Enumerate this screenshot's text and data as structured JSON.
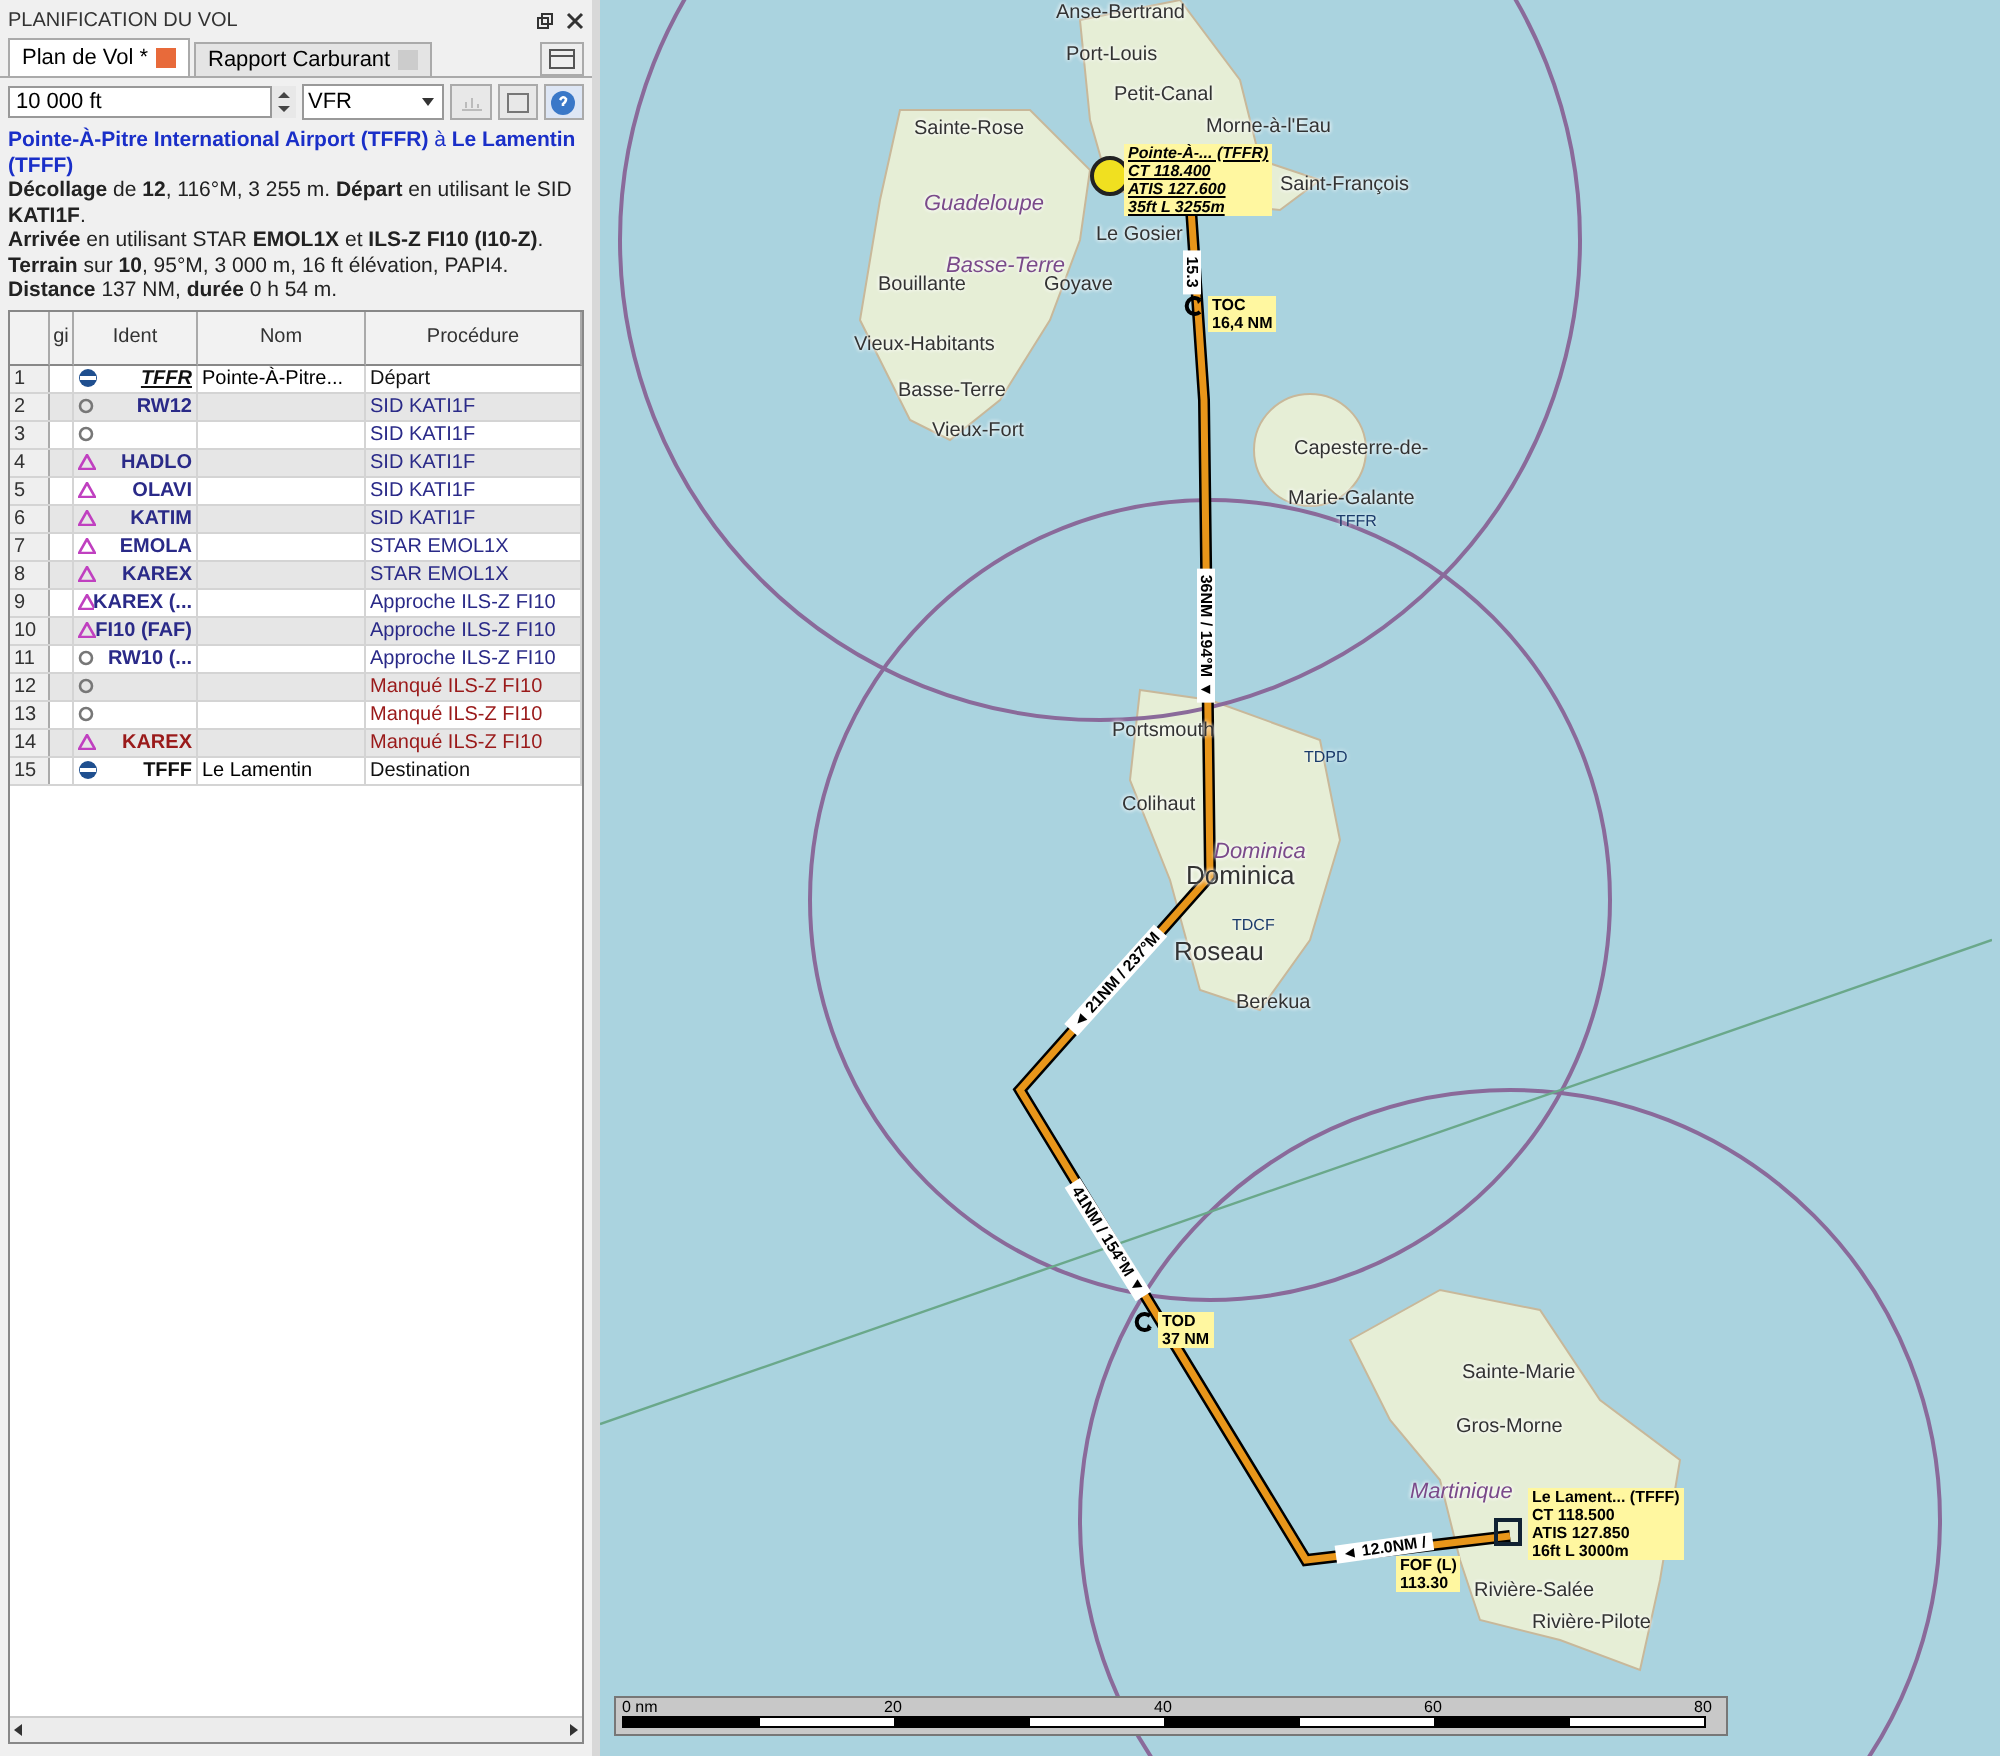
{
  "panel": {
    "title": "PLANIFICATION DU VOL",
    "tabs": [
      {
        "label": "Plan de Vol *",
        "selected": true
      },
      {
        "label": "Rapport Carburant",
        "selected": false
      }
    ],
    "altitude": "10 000 ft",
    "flight_rules": "VFR",
    "route": "**Pointe-À-Pitre International Airport (TFFR)** à **Le Lamentin (TFFF)**",
    "summary": [
      "**Décollage** de **12**, 116°M, 3 255 m. **Départ** en utilisant le SID **KATI1F**.",
      "**Arrivée** en utilisant STAR **EMOL1X** et **ILS-Z FI10 (I10-Z)**.",
      "**Terrain** sur **10**, 95°M, 3 000 m, 16 ft élévation, PAPI4.",
      "**Distance** 137 NM, **durée** 0 h 54 m."
    ]
  },
  "table": {
    "columns": [
      "gi",
      "Ident",
      "Nom",
      "Procédure"
    ],
    "rows": [
      {
        "num": "1",
        "kind": "departure",
        "ident": "TFFR",
        "name": "Pointe-À-Pitre...",
        "procedure": "Départ",
        "color": "#111111"
      },
      {
        "num": "2",
        "kind": "point",
        "ident": "RW12",
        "procedure": "SID KATI1F",
        "color": "#2a2a88"
      },
      {
        "num": "3",
        "kind": "point",
        "procedure": "SID KATI1F",
        "color": "#2a2a88"
      },
      {
        "num": "4",
        "kind": "fix",
        "ident": "HADLO",
        "procedure": "SID KATI1F",
        "color": "#2a2a88"
      },
      {
        "num": "5",
        "kind": "fix",
        "ident": "OLAVI",
        "procedure": "SID KATI1F",
        "color": "#2a2a88"
      },
      {
        "num": "6",
        "kind": "fix",
        "ident": "KATIM",
        "procedure": "SID KATI1F",
        "color": "#2a2a88"
      },
      {
        "num": "7",
        "kind": "fix",
        "ident": "EMOLA",
        "procedure": "STAR EMOL1X",
        "color": "#2a2a88"
      },
      {
        "num": "8",
        "kind": "fix",
        "ident": "KAREX",
        "procedure": "STAR EMOL1X",
        "color": "#2a2a88"
      },
      {
        "num": "9",
        "kind": "fix",
        "ident": "KAREX (...",
        "procedure": "Approche ILS-Z FI10",
        "color": "#2a2a88"
      },
      {
        "num": "10",
        "kind": "fix",
        "ident": "FI10 (FAF)",
        "procedure": "Approche ILS-Z FI10",
        "color": "#2a2a88"
      },
      {
        "num": "11",
        "kind": "point",
        "ident": "RW10 (...",
        "procedure": "Approche ILS-Z FI10",
        "color": "#2a2a88"
      },
      {
        "num": "12",
        "kind": "point",
        "procedure": "Manqué ILS-Z FI10",
        "color": "#9a1a1a"
      },
      {
        "num": "13",
        "kind": "point",
        "procedure": "Manqué ILS-Z FI10",
        "color": "#9a1a1a"
      },
      {
        "num": "14",
        "kind": "fix",
        "ident": "KAREX",
        "procedure": "Manqué ILS-Z FI10",
        "color": "#9a1a1a"
      },
      {
        "num": "15",
        "kind": "destination",
        "ident": "TFFF",
        "name": "Le Lamentin",
        "procedure": "Destination",
        "color": "#111111"
      }
    ]
  },
  "map": {
    "places": [
      {
        "name": "Anse-Bertrand",
        "kind": "town"
      },
      {
        "name": "Port-Louis",
        "kind": "town"
      },
      {
        "name": "Petit-Canal",
        "kind": "town"
      },
      {
        "name": "Sainte-Rose",
        "kind": "town"
      },
      {
        "name": "Morne-à-l'Eau",
        "kind": "town"
      },
      {
        "name": "Guadeloupe",
        "kind": "region"
      },
      {
        "name": "Saint-François",
        "kind": "town"
      },
      {
        "name": "Le Gosier",
        "kind": "town"
      },
      {
        "name": "Basse-Terre",
        "kind": "region"
      },
      {
        "name": "Bouillante",
        "kind": "town"
      },
      {
        "name": "Goyave",
        "kind": "town"
      },
      {
        "name": "Vieux-Habitants",
        "kind": "town"
      },
      {
        "name": "Basse-Terre",
        "kind": "town"
      },
      {
        "name": "Vieux-Fort",
        "kind": "town"
      },
      {
        "name": "Capesterre-de-",
        "kind": "town"
      },
      {
        "name": "Marie-Galante",
        "kind": "town"
      },
      {
        "name": "Portsmouth",
        "kind": "town"
      },
      {
        "name": "Colihaut",
        "kind": "town"
      },
      {
        "name": "Dominica",
        "kind": "region"
      },
      {
        "name": "Dominica",
        "kind": "country"
      },
      {
        "name": "Roseau",
        "kind": "city"
      },
      {
        "name": "Berekua",
        "kind": "town"
      },
      {
        "name": "Sainte-Marie",
        "kind": "town"
      },
      {
        "name": "Gros-Morne",
        "kind": "town"
      },
      {
        "name": "Martinique",
        "kind": "region"
      },
      {
        "name": "Rivière-Salée",
        "kind": "town"
      },
      {
        "name": "Rivière-Pilote",
        "kind": "town"
      }
    ],
    "airports": [
      "TFFR",
      "TDPD",
      "TDCF"
    ],
    "legs": [
      "15.3",
      "36NM / 194°M ▼",
      "◄ 21NM / 237°M",
      "41NM / 154°M ▼",
      "◄ 12.0NM /"
    ],
    "markers": [
      {
        "kind": "toc",
        "lines": [
          "TOC",
          "16,4 NM"
        ]
      },
      {
        "kind": "tod",
        "lines": [
          "TOD",
          "37 NM"
        ]
      }
    ],
    "airport_boxes": [
      {
        "kind": "departure",
        "lines": [
          "Pointe-À-... (TFFR)",
          "CT 118.400",
          "ATIS 127.600",
          "35ft L 3255m"
        ]
      },
      {
        "kind": "destination",
        "lines": [
          "Le Lament... (TFFF)",
          "CT 118.500",
          "ATIS 127.850",
          "16ft L 3000m"
        ]
      }
    ],
    "navaid": [
      "FOF (L)",
      "113.30"
    ],
    "scale": [
      "0 nm",
      "20",
      "40",
      "60",
      "80"
    ]
  }
}
